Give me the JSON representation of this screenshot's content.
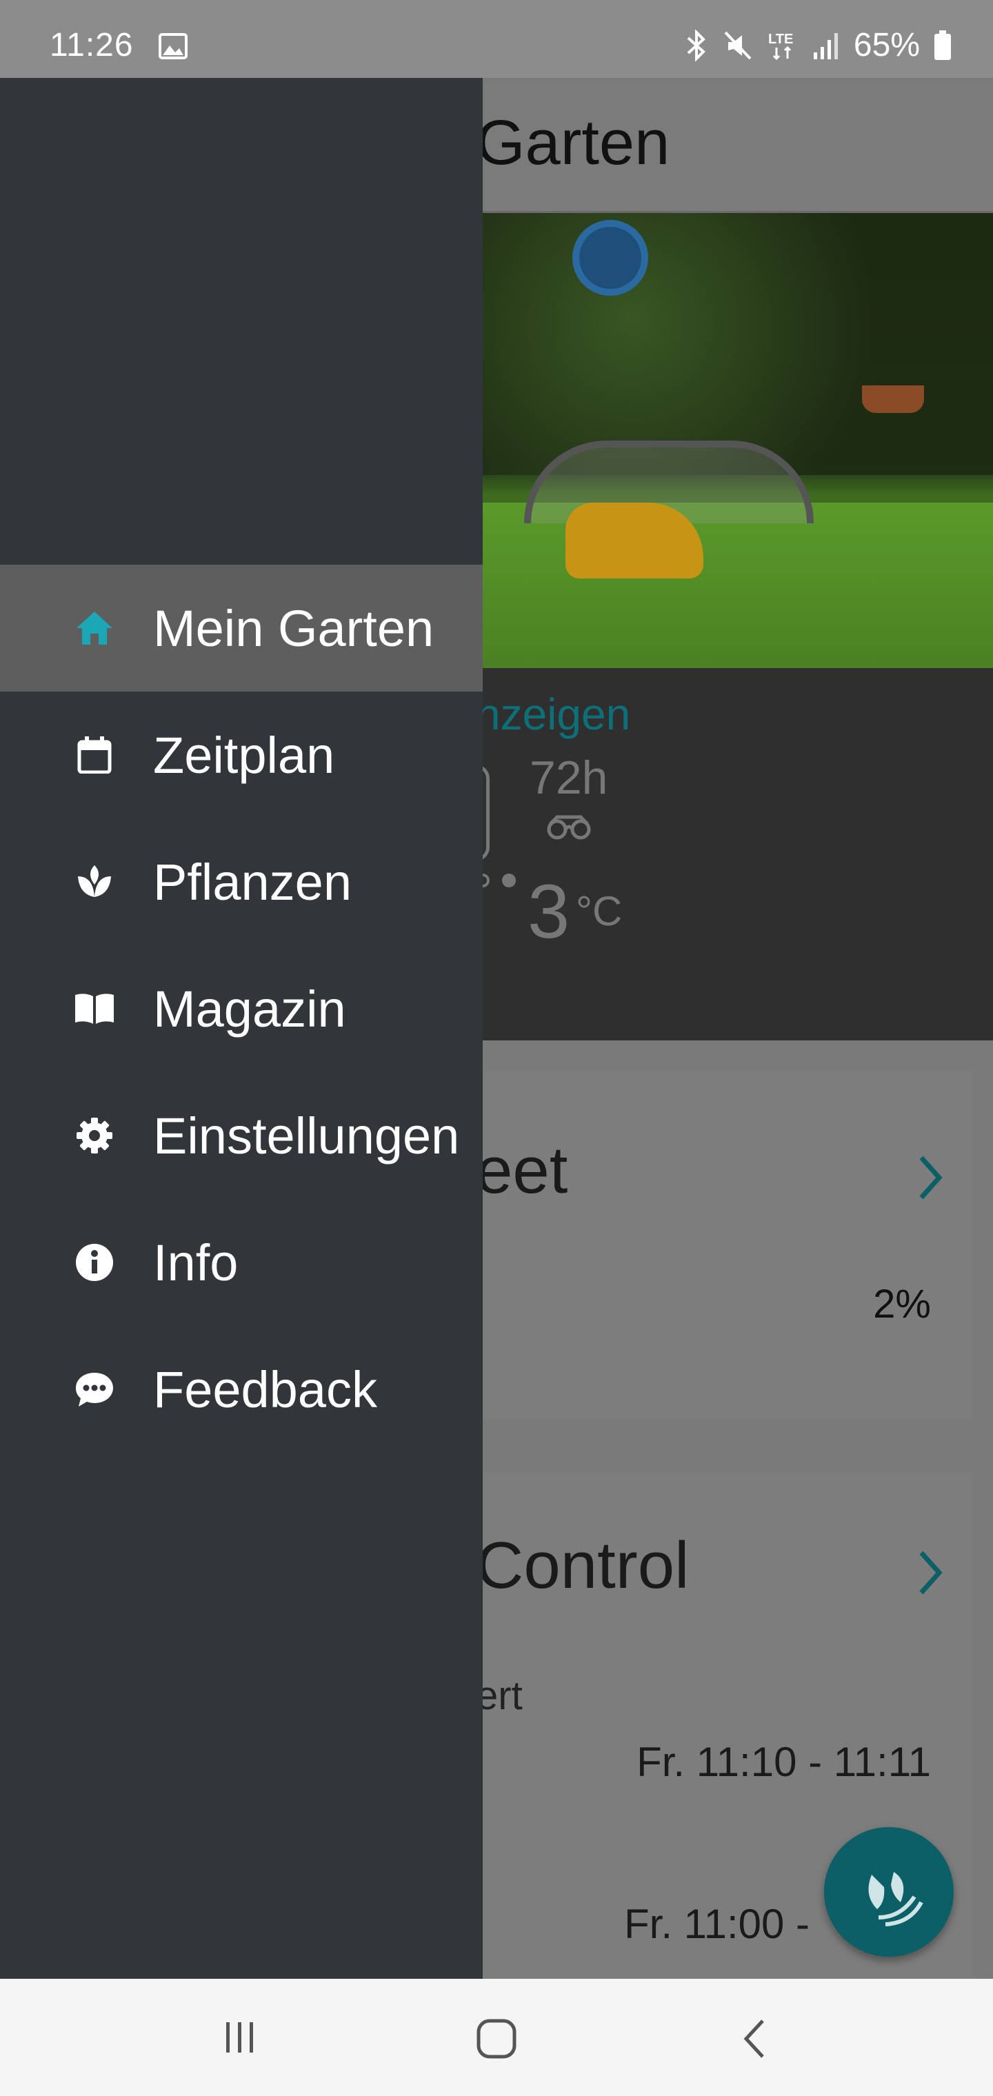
{
  "status_bar": {
    "time": "11:26",
    "battery": "65%",
    "icons": [
      "image-icon",
      "bluetooth-icon",
      "mute-icon",
      "lte-icon",
      "signal-icon",
      "battery-icon"
    ]
  },
  "background_app": {
    "title": "Garten",
    "hero_link": "nzeigen",
    "hours": "72h",
    "temperature": "3",
    "temperature_unit": "°C",
    "card1": {
      "title": "eet",
      "percent": "2%"
    },
    "card2": {
      "title": "Control",
      "subtitle": "ert",
      "schedule_1": "Fr. 11:10 - 11:11",
      "schedule_2": "Fr. 11:00 -"
    }
  },
  "drawer": {
    "items": [
      {
        "label": "Mein Garten",
        "icon": "home-icon",
        "active": true
      },
      {
        "label": "Zeitplan",
        "icon": "calendar-icon",
        "active": false
      },
      {
        "label": "Pflanzen",
        "icon": "plant-icon",
        "active": false
      },
      {
        "label": "Magazin",
        "icon": "book-icon",
        "active": false
      },
      {
        "label": "Einstellungen",
        "icon": "gear-icon",
        "active": false
      },
      {
        "label": "Info",
        "icon": "info-icon",
        "active": false
      },
      {
        "label": "Feedback",
        "icon": "feedback-icon",
        "active": false
      }
    ]
  },
  "colors": {
    "accent": "#1ba7b5",
    "drawer_bg": "#32363a",
    "drawer_active_bg": "#5e5e5e",
    "link_teal": "#0d6f78"
  }
}
